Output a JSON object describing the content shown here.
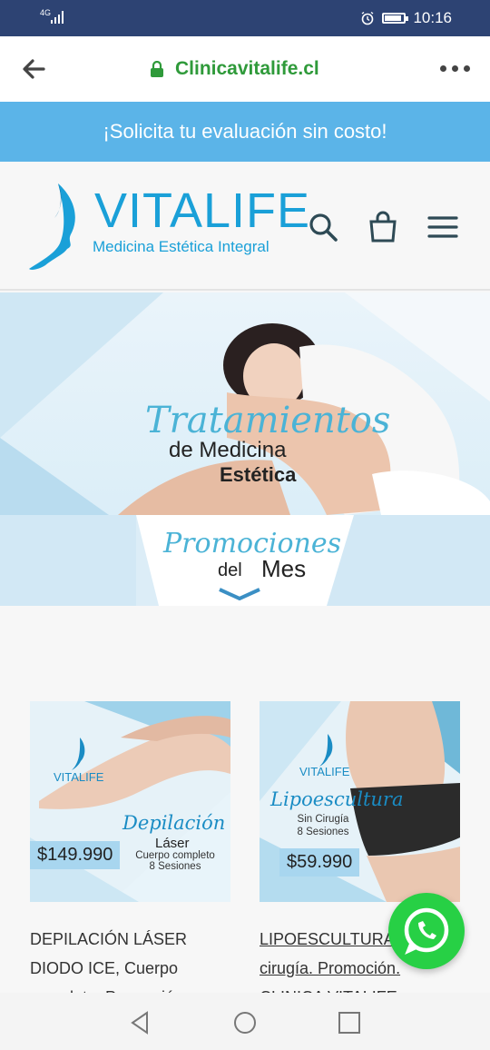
{
  "status_bar": {
    "network": "4G",
    "time": "10:16",
    "icons": [
      "signal-icon",
      "alarm-icon",
      "battery-icon"
    ]
  },
  "browser": {
    "url": "Clinicavitalife.cl",
    "icons": [
      "back-arrow-icon",
      "lock-icon",
      "more-options-icon"
    ]
  },
  "promo_banner": {
    "text": "¡Solicita tu evaluación sin costo!"
  },
  "header": {
    "logo_title": "VITALIFE",
    "logo_subtitle": "Medicina Estética Integral",
    "icons": [
      "search-icon",
      "cart-icon",
      "menu-icon"
    ]
  },
  "hero": {
    "line1": "Tratamientos",
    "line2": "de Medicina",
    "line3": "Estética"
  },
  "promotions": {
    "line1": "Promociones",
    "line2": "del",
    "line3": "Mes"
  },
  "products": [
    {
      "brand": "VITALIFE",
      "script": "Depilación",
      "label": "Láser",
      "detail1": "Cuerpo completo",
      "detail2": "8 Sesiones",
      "price": "$149.990",
      "title": "DEPILACIÓN LÁSER DIODO ICE, Cuerpo completo. Promoción"
    },
    {
      "brand": "VITALIFE",
      "script": "Lipoescultura",
      "detail1": "Sin Cirugía",
      "detail2": "8 Sesiones",
      "price": "$59.990",
      "title": "LIPOESCULTURA sin cirugía. Promoción. CLINICA VITALIFE"
    }
  ],
  "colors": {
    "status_bar": "#2d4373",
    "accent_blue": "#5bb4e8",
    "brand_blue": "#1aa0d8",
    "secure_green": "#2f9a3a",
    "whatsapp_green": "#27d045"
  },
  "android_nav": {
    "icons": [
      "back-triangle-icon",
      "home-circle-icon",
      "recents-square-icon"
    ]
  },
  "whatsapp": {
    "icon": "whatsapp-icon"
  }
}
